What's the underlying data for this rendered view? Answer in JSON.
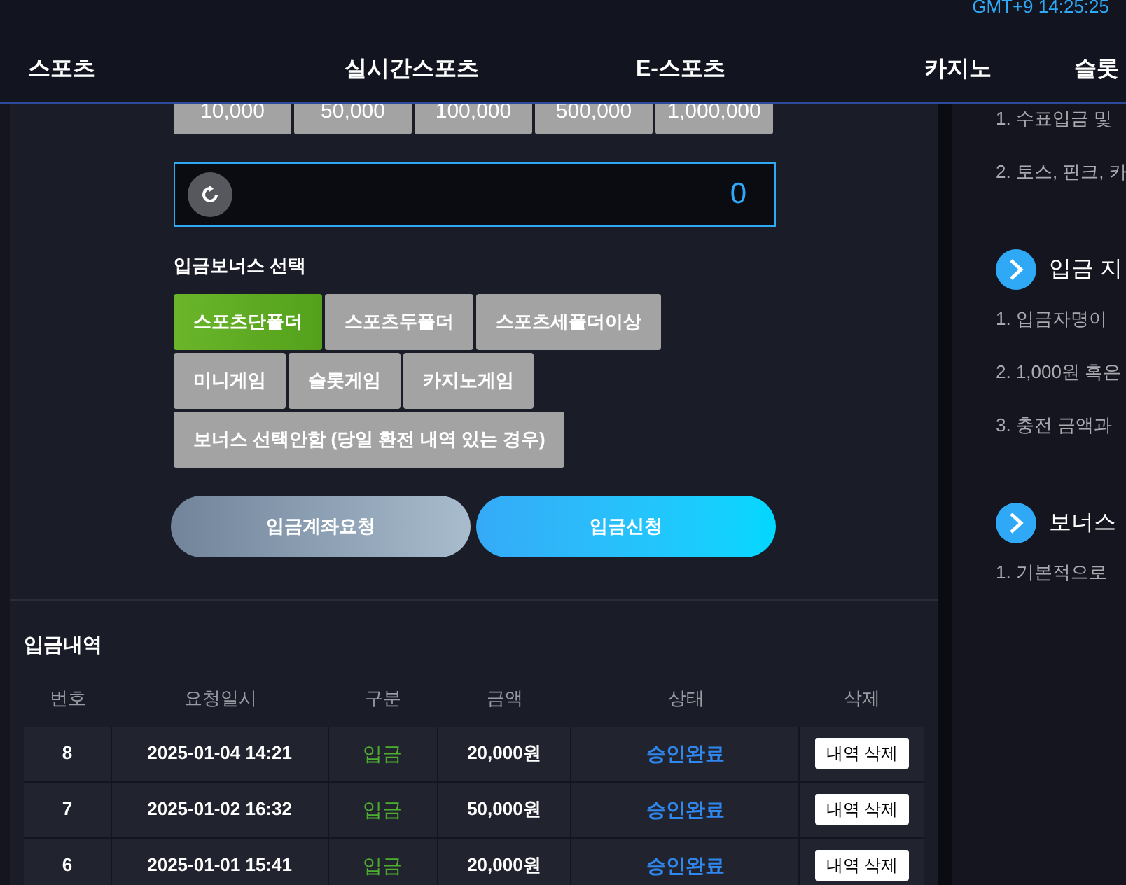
{
  "clock": "GMT+9 14:25:25",
  "nav": [
    {
      "label": "스포츠",
      "selected": false
    },
    {
      "label": "실시간스포츠",
      "selected": false
    },
    {
      "label": "E-스포츠",
      "selected": false
    },
    {
      "label": "카지노",
      "selected": false
    },
    {
      "label": "슬롯",
      "selected": false
    }
  ],
  "amount_buttons": [
    "10,000",
    "50,000",
    "100,000",
    "500,000",
    "1,000,000"
  ],
  "amount_field": {
    "value": "0"
  },
  "bonus": {
    "title": "입금보너스 선택",
    "options": [
      {
        "label": "스포츠단폴더",
        "selected": true
      },
      {
        "label": "스포츠두폴더",
        "selected": false
      },
      {
        "label": "스포츠세폴더이상",
        "selected": false
      },
      {
        "label": "미니게임",
        "selected": false
      },
      {
        "label": "슬롯게임",
        "selected": false
      },
      {
        "label": "카지노게임",
        "selected": false
      },
      {
        "label": "보너스 선택안함 (당일 환전 내역 있는 경우)",
        "selected": false
      }
    ]
  },
  "actions": [
    {
      "label": "입금계좌요청",
      "kind": "secondary"
    },
    {
      "label": "입금신청",
      "kind": "primary"
    }
  ],
  "history": {
    "title": "입금내역",
    "columns": [
      "번호",
      "요청일시",
      "구분",
      "금액",
      "상태",
      "삭제"
    ],
    "rows": [
      {
        "no": "8",
        "date": "2025-01-04 14:21",
        "type": "입금",
        "amount": "20,000원",
        "status": "승인완료",
        "action": "내역 삭제"
      },
      {
        "no": "7",
        "date": "2025-01-02 16:32",
        "type": "입금",
        "amount": "50,000원",
        "status": "승인완료",
        "action": "내역 삭제"
      },
      {
        "no": "6",
        "date": "2025-01-01 15:41",
        "type": "입금",
        "amount": "20,000원",
        "status": "승인완료",
        "action": "내역 삭제"
      }
    ]
  },
  "notice": [
    {
      "kind": "line",
      "text": "1. 수표입금 및"
    },
    {
      "kind": "line",
      "text": "2. 토스, 핀크, 카"
    },
    {
      "kind": "heading",
      "text": "입금 지"
    },
    {
      "kind": "line",
      "text": "1. 입금자명이"
    },
    {
      "kind": "line",
      "text": "2. 1,000원 혹은"
    },
    {
      "kind": "line",
      "text": "3. 충전 금액과"
    },
    {
      "kind": "heading",
      "text": "보너스"
    },
    {
      "kind": "line",
      "text": "1. 기본적으로"
    }
  ]
}
